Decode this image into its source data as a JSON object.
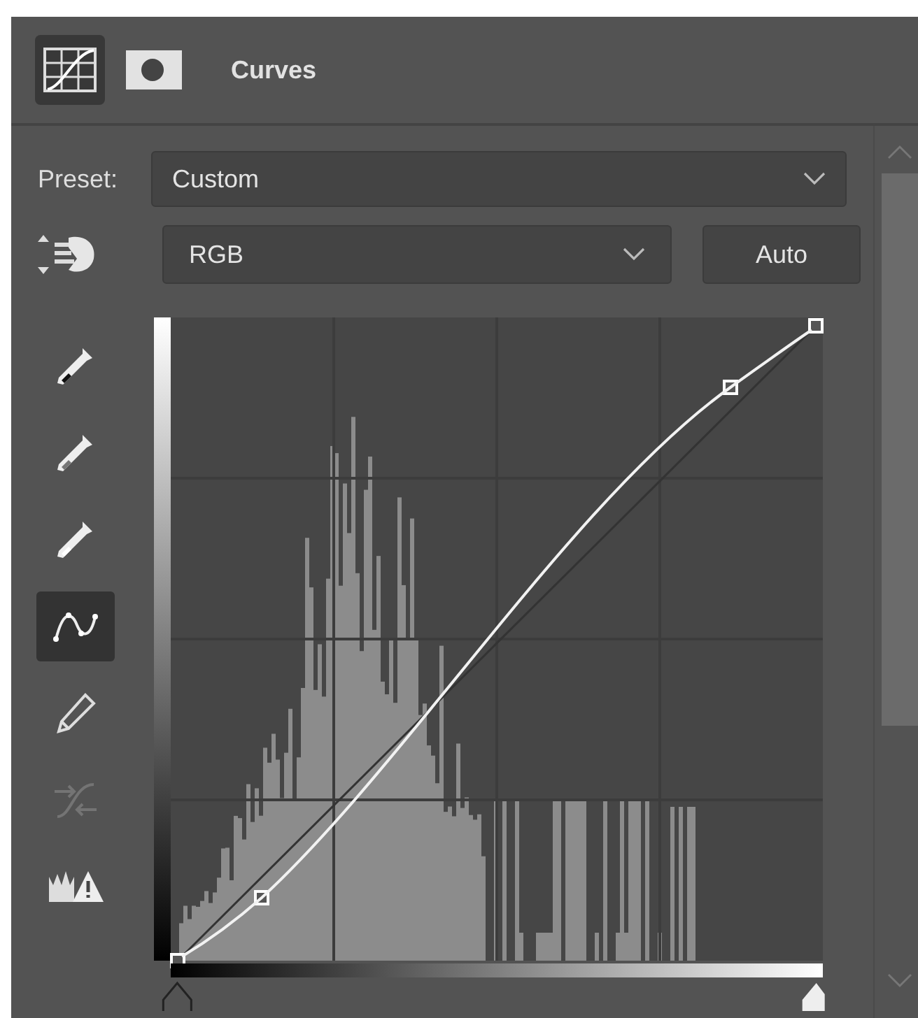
{
  "header": {
    "title": "Curves",
    "icons": [
      {
        "kind": "curves",
        "selected": true
      },
      {
        "kind": "mask",
        "selected": false
      }
    ]
  },
  "preset": {
    "label": "Preset:",
    "value": "Custom"
  },
  "channel": {
    "value": "RGB",
    "button": "Auto"
  },
  "input_sliders": [
    {
      "kind": "shadow",
      "level": 0.01
    },
    {
      "kind": "highlight",
      "level": 0.99
    }
  ],
  "tools": [
    {
      "kind": "eyedropper-black",
      "selected": false,
      "disabled": false
    },
    {
      "kind": "eyedropper-gray",
      "selected": false,
      "disabled": false
    },
    {
      "kind": "eyedropper-white",
      "selected": false,
      "disabled": false
    },
    {
      "kind": "points",
      "selected": true,
      "disabled": false
    },
    {
      "kind": "pencil",
      "selected": false,
      "disabled": false
    },
    {
      "kind": "smooth",
      "selected": false,
      "disabled": true
    },
    {
      "kind": "clipping",
      "selected": false,
      "disabled": false
    }
  ]
}
